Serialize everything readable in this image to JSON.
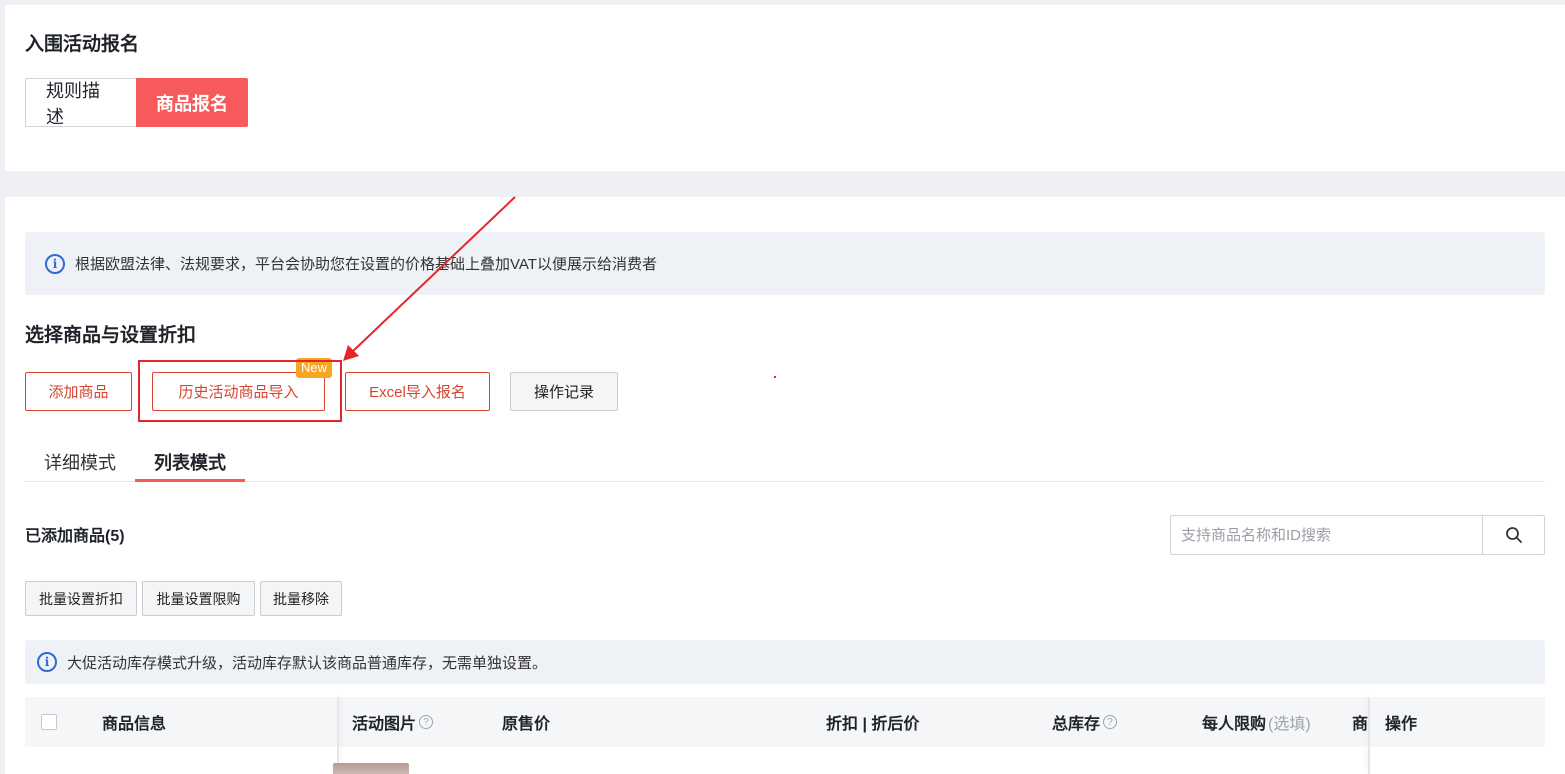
{
  "header": {
    "title": "入围活动报名",
    "segments": [
      "规则描述",
      "商品报名"
    ],
    "active_segment": "商品报名"
  },
  "info_banner": {
    "icon": "info-icon",
    "text": "根据欧盟法律、法规要求，平台会协助您在设置的价格基础上叠加VAT以便展示给消费者"
  },
  "section": {
    "title": "选择商品与设置折扣",
    "actions": {
      "add_product": "添加商品",
      "history_import": "历史活动商品导入",
      "history_badge": "New",
      "excel_import": "Excel导入报名",
      "operation_log": "操作记录"
    }
  },
  "tabs": {
    "detail": "详细模式",
    "list": "列表模式",
    "active": "列表模式"
  },
  "added": {
    "title": "已添加商品(5)",
    "search_placeholder": "支持商品名称和ID搜索",
    "search_icon": "search-icon"
  },
  "batch_actions": {
    "set_discount": "批量设置折扣",
    "set_limit": "批量设置限购",
    "remove": "批量移除"
  },
  "notice": {
    "icon": "info-icon",
    "text": "大促活动库存模式升级，活动库存默认该商品普通库存，无需单独设置。"
  },
  "table": {
    "columns": {
      "product_info": "商品信息",
      "activity_image": "活动图片",
      "original_price": "原售价",
      "discount_price": "折扣 | 折后价",
      "total_stock": "总库存",
      "per_person_limit": "每人限购",
      "per_person_limit_optional": "(选填)",
      "truncated": "商",
      "actions": "操作"
    }
  },
  "colors": {
    "accent_red": "#f65a5a",
    "outline_red": "#d9442e",
    "badge_orange": "#f6a623",
    "annotation_red": "#e3262a",
    "info_blue": "#2f6bd6"
  }
}
